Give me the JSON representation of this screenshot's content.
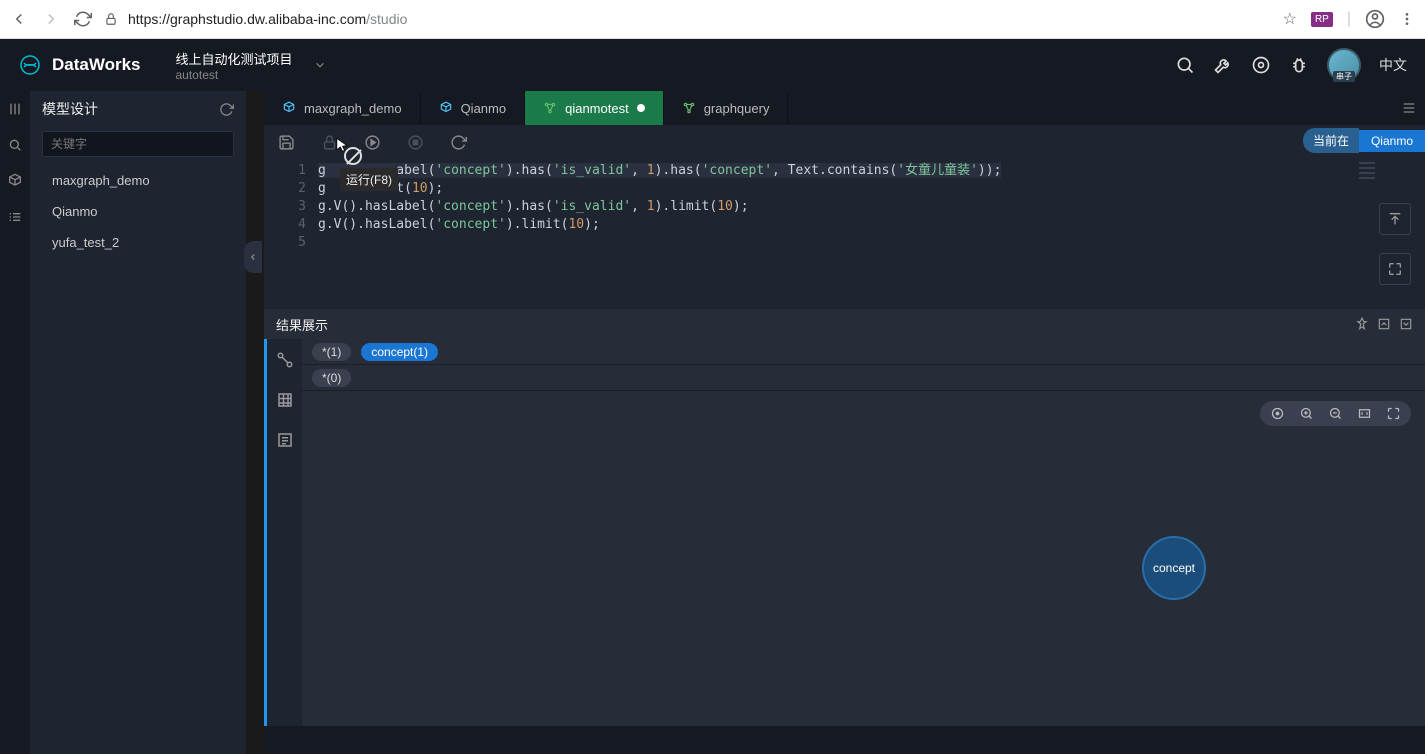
{
  "browser": {
    "url_host": "https://graphstudio.dw.alibaba-inc.com",
    "url_path": "/studio",
    "rp_label": "RP"
  },
  "header": {
    "app_name": "DataWorks",
    "project_name": "线上自动化测试项目",
    "project_sub": "autotest",
    "avatar_label": "串子",
    "lang": "中文"
  },
  "sidebar": {
    "title": "模型设计",
    "search_placeholder": "关键字",
    "items": [
      "maxgraph_demo",
      "Qianmo",
      "yufa_test_2"
    ]
  },
  "tabs": [
    {
      "label": "maxgraph_demo",
      "icon": "cube",
      "active": false
    },
    {
      "label": "Qianmo",
      "icon": "cube",
      "active": false
    },
    {
      "label": "qianmotest",
      "icon": "graph",
      "active": true,
      "dirty": true
    },
    {
      "label": "graphquery",
      "icon": "graph",
      "active": false
    }
  ],
  "toolbar": {
    "run_tooltip": "运行(F8)",
    "current_label": "当前在",
    "current_value": "Qianmo"
  },
  "editor": {
    "lines": [
      {
        "n": "1",
        "prefix": "g",
        "obscured": "    .   .",
        "rest_parts": [
          "abel(",
          "'concept'",
          ").has(",
          "'is_valid'",
          ", ",
          "1",
          ").has(",
          "'concept'",
          ", Text.contains(",
          "'女童儿童装'",
          "));"
        ],
        "highlighted": true
      },
      {
        "n": "2",
        "prefix": "g",
        "obscured": "         ",
        "rest_parts": [
          "t(",
          "10",
          ");"
        ]
      },
      {
        "n": "3",
        "raw_parts": [
          "g.V().hasLabel(",
          "'concept'",
          ").has(",
          "'is_valid'",
          ", ",
          "1",
          ").limit(",
          "10",
          ");"
        ]
      },
      {
        "n": "4",
        "raw_parts": [
          "g.V().hasLabel(",
          "'concept'",
          ").limit(",
          "10",
          ");"
        ]
      },
      {
        "n": "5",
        "raw_parts": [
          ""
        ]
      }
    ]
  },
  "results": {
    "title": "结果展示",
    "row1_chips": [
      {
        "label": "*(1)",
        "blue": false
      },
      {
        "label": "concept(1)",
        "blue": true
      }
    ],
    "row2_chips": [
      {
        "label": "*(0)",
        "blue": false
      }
    ],
    "node_label": "concept"
  }
}
